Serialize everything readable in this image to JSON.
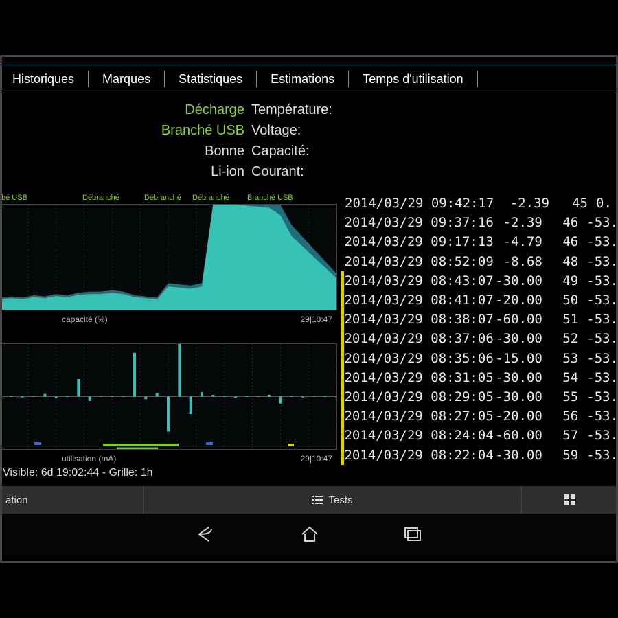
{
  "tabs": [
    "Historiques",
    "Marques",
    "Statistiques",
    "Estimations",
    "Temps d'utilisation"
  ],
  "status": {
    "discharge": "Décharge",
    "plugged": "Branché USB",
    "good": "Bonne",
    "tech": "Li-ion",
    "temp": "Température:",
    "volt": "Voltage:",
    "cap": "Capacité:",
    "cur": "Courant:"
  },
  "chart_data": [
    {
      "type": "area",
      "title": "capacité (%)",
      "xrange_label": "29|10:47",
      "ylim": [
        0,
        100
      ],
      "markers": [
        "bé USB",
        "Débranché",
        "Débranché",
        "Débranché",
        "Branché USB"
      ],
      "series": [
        {
          "name": "capacity",
          "values": [
            10,
            11,
            10,
            12,
            11,
            13,
            12,
            14,
            15,
            15,
            16,
            15,
            12,
            11,
            10,
            22,
            21,
            20,
            22,
            100,
            100,
            100,
            99,
            98,
            97,
            90,
            70,
            60,
            50,
            40,
            30
          ]
        }
      ]
    },
    {
      "type": "line",
      "title": "utilisation (mA)",
      "xrange_label": "29|10:47",
      "ylim": [
        -600,
        600
      ],
      "series": [
        {
          "name": "mA",
          "values": [
            20,
            10,
            -10,
            5,
            30,
            -20,
            10,
            200,
            -50,
            5,
            10,
            -5,
            500,
            -30,
            40,
            -400,
            600,
            -200,
            50,
            20,
            10,
            -15,
            10,
            -5,
            20,
            -80,
            10,
            -10,
            5,
            10,
            -5
          ]
        }
      ]
    }
  ],
  "log": {
    "rows": [
      {
        "ts": "2014/03/29 09:42:17",
        "ma": "-2.39",
        "pct": "45",
        "v": "0.",
        "mark": false
      },
      {
        "ts": "2014/03/29 09:37:16",
        "ma": "-2.39",
        "pct": "46",
        "v": "-53.",
        "mark": false
      },
      {
        "ts": "2014/03/29 09:17:13",
        "ma": "-4.79",
        "pct": "46",
        "v": "-53.",
        "mark": false
      },
      {
        "ts": "2014/03/29 08:52:09",
        "ma": "-8.68",
        "pct": "48",
        "v": "-53.",
        "mark": false
      },
      {
        "ts": "2014/03/29 08:43:07",
        "ma": "-30.00",
        "pct": "49",
        "v": "-53.",
        "mark": true
      },
      {
        "ts": "2014/03/29 08:41:07",
        "ma": "-20.00",
        "pct": "50",
        "v": "-53.",
        "mark": true
      },
      {
        "ts": "2014/03/29 08:38:07",
        "ma": "-60.00",
        "pct": "51",
        "v": "-53.",
        "mark": true
      },
      {
        "ts": "2014/03/29 08:37:06",
        "ma": "-30.00",
        "pct": "52",
        "v": "-53.",
        "mark": true
      },
      {
        "ts": "2014/03/29 08:35:06",
        "ma": "-15.00",
        "pct": "53",
        "v": "-53.",
        "mark": true
      },
      {
        "ts": "2014/03/29 08:31:05",
        "ma": "-30.00",
        "pct": "54",
        "v": "-53.",
        "mark": true
      },
      {
        "ts": "2014/03/29 08:29:05",
        "ma": "-30.00",
        "pct": "55",
        "v": "-53.",
        "mark": true
      },
      {
        "ts": "2014/03/29 08:27:05",
        "ma": "-20.00",
        "pct": "56",
        "v": "-53.",
        "mark": true
      },
      {
        "ts": "2014/03/29 08:24:04",
        "ma": "-60.00",
        "pct": "57",
        "v": "-53.",
        "mark": true
      },
      {
        "ts": "2014/03/29 08:22:04",
        "ma": "-30.00",
        "pct": "59",
        "v": "-53.",
        "mark": true
      }
    ]
  },
  "footer": {
    "text": "Visible: 6d 19:02:44 - Grille: 1h"
  },
  "bottombar": {
    "left": "ation",
    "mid": "Tests"
  }
}
